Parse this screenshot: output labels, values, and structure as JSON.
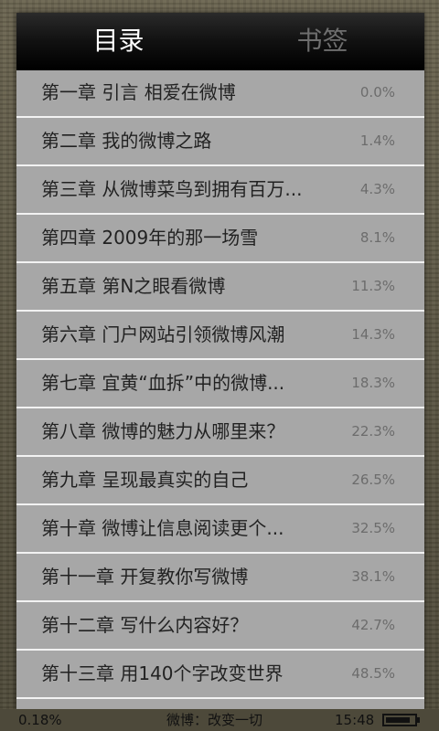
{
  "tabs": {
    "contents": "目录",
    "bookmarks": "书签"
  },
  "chapters": [
    {
      "title": "第一章 引言 相爱在微博",
      "pct": "0.0%"
    },
    {
      "title": "第二章 我的微博之路",
      "pct": "1.4%"
    },
    {
      "title": "第三章 从微博菜鸟到拥有百万...",
      "pct": "4.3%"
    },
    {
      "title": "第四章 2009年的那一场雪",
      "pct": "8.1%"
    },
    {
      "title": "第五章 第N之眼看微博",
      "pct": "11.3%"
    },
    {
      "title": "第六章 门户网站引领微博风潮",
      "pct": "14.3%"
    },
    {
      "title": "第七章 宜黄“血拆”中的微博...",
      "pct": "18.3%"
    },
    {
      "title": "第八章 微博的魅力从哪里来？",
      "pct": "22.3%"
    },
    {
      "title": "第九章 呈现最真实的自己",
      "pct": "26.5%"
    },
    {
      "title": "第十章 微博让信息阅读更个...",
      "pct": "32.5%"
    },
    {
      "title": "第十一章 开复教你写微博",
      "pct": "38.1%"
    },
    {
      "title": "第十二章 写什么内容好？",
      "pct": "42.7%"
    },
    {
      "title": "第十三章 用140个字改变世界",
      "pct": "48.5%"
    }
  ],
  "status": {
    "progress": "0.18%",
    "book_title": "微博：改变一切",
    "time": "15:48",
    "battery_level": 0.85
  }
}
